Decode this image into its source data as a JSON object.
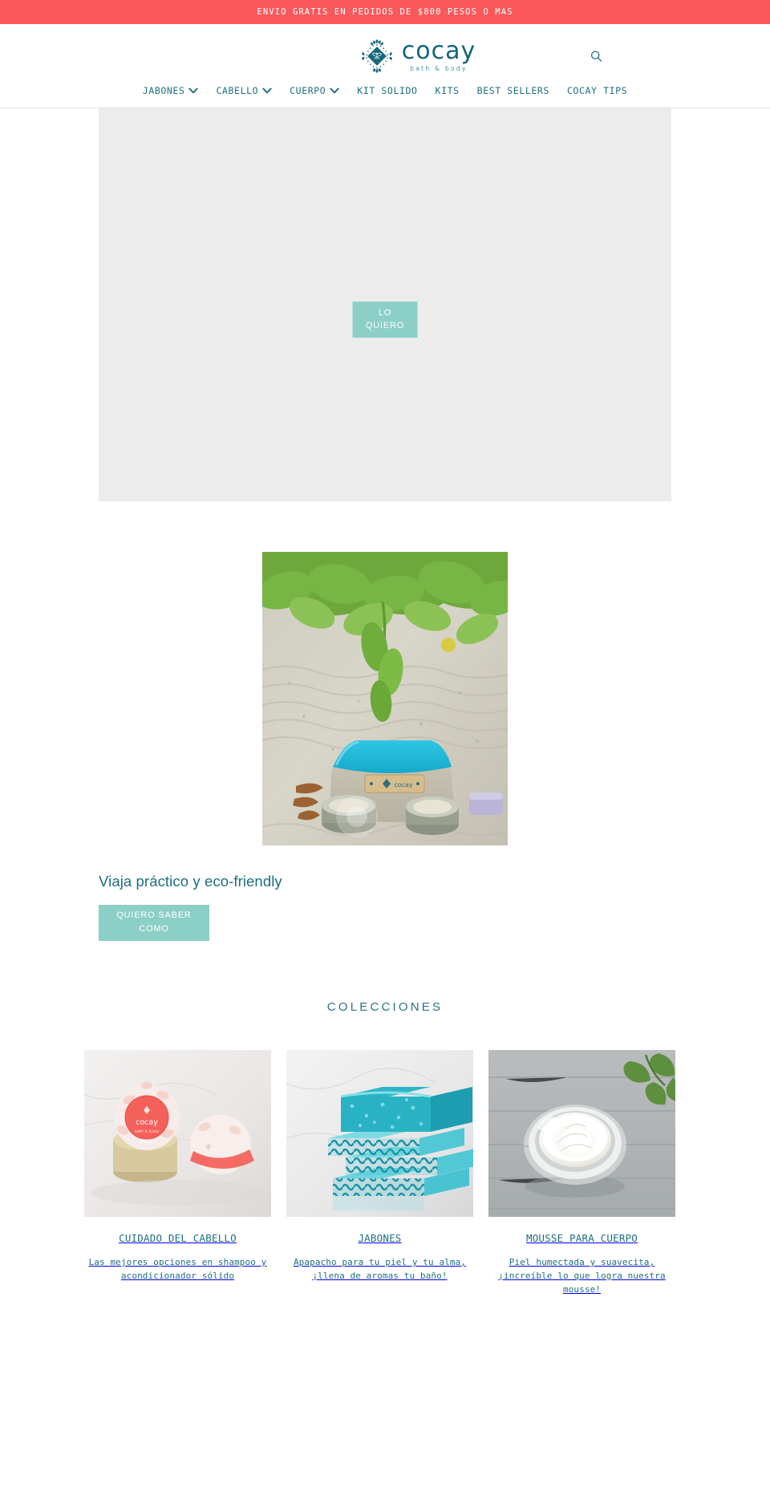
{
  "announcement": {
    "text": "ENVIO GRATIS EN PEDIDOS DE $800 PESOS O MAS",
    "background": "#f9595b",
    "color": "#ffffff"
  },
  "header": {
    "logo": {
      "word": "cocay",
      "tagline": "bath & body",
      "mark_icon": "diamond-firefly-logo-icon",
      "color": "#12667b"
    },
    "search_icon": "search-icon",
    "nav": [
      {
        "label": "JABONES",
        "has_dropdown": true,
        "icon": "chevron-down-icon"
      },
      {
        "label": "CABELLO",
        "has_dropdown": true,
        "icon": "chevron-down-icon"
      },
      {
        "label": "CUERPO",
        "has_dropdown": true,
        "icon": "chevron-down-icon"
      },
      {
        "label": "KIT SOLIDO",
        "has_dropdown": false
      },
      {
        "label": "KITS",
        "has_dropdown": false
      },
      {
        "label": "BEST SELLERS",
        "has_dropdown": false
      },
      {
        "label": "COCAY TIPS",
        "has_dropdown": false
      }
    ],
    "nav_color": "#1c6e80"
  },
  "hero": {
    "background": "#ececec",
    "cta_line1": "LO",
    "cta_line2": "QUIERO",
    "cta_color": "#8ccfc6"
  },
  "feature": {
    "image_alt": "travel-pouch-photo",
    "title": "Viaja práctico y eco-friendly",
    "cta_line1": "QUIERO SABER",
    "cta_line2": "COMO",
    "cta_color": "#8ccfc6"
  },
  "collections": {
    "title": "COLECCIONES",
    "cards": [
      {
        "image_alt": "solid-conditioner-bars-photo",
        "title": "CUIDADO DEL CABELLO",
        "desc": "Las mejores opciones en shampoo y acondicionador sólido"
      },
      {
        "image_alt": "turquoise-soap-bars-photo",
        "title": "JABONES",
        "desc": "Apapacho para tu piel y tu alma, ¡llena de aromas tu baño!"
      },
      {
        "image_alt": "body-mousse-jar-photo",
        "title": "MOUSSE PARA CUERPO",
        "desc": "Piel humectada y suavecita, ¡increíble lo que logra nuestra mousse!"
      }
    ]
  }
}
